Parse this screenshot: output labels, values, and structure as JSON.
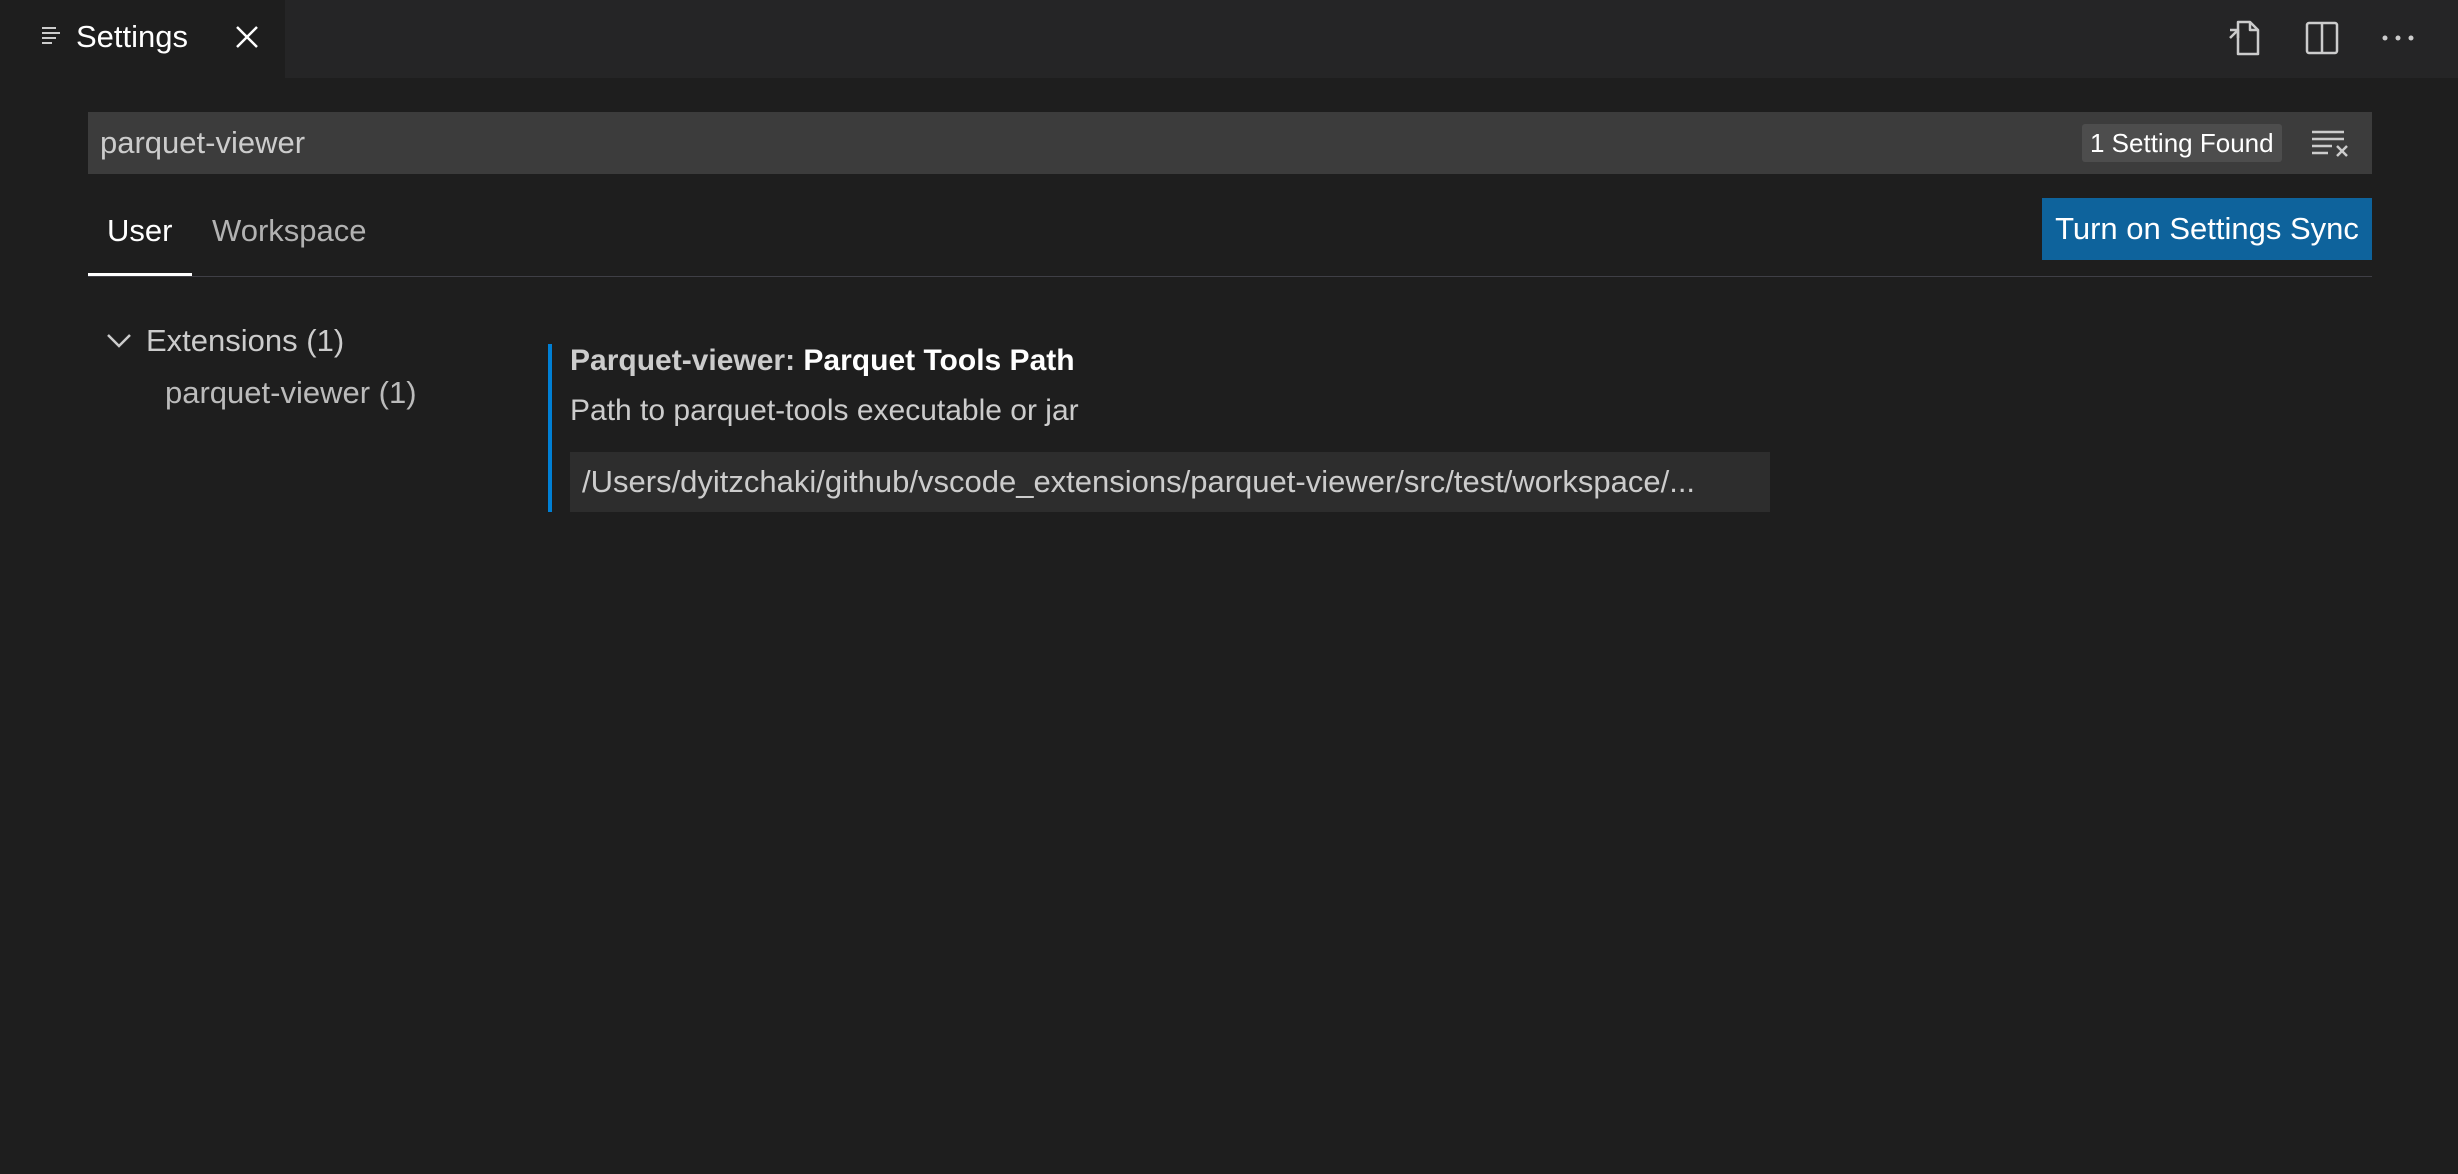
{
  "tab": {
    "title": "Settings"
  },
  "search": {
    "value": "parquet-viewer",
    "result_count": "1 Setting Found"
  },
  "scopes": {
    "user": "User",
    "workspace": "Workspace"
  },
  "sync_button": "Turn on Settings Sync",
  "toc": {
    "group": "Extensions (1)",
    "item": "parquet-viewer (1)"
  },
  "setting": {
    "category": "Parquet-viewer: ",
    "name": "Parquet Tools Path",
    "description": "Path to parquet-tools executable or jar",
    "value": "/Users/dyitzchaki/github/vscode_extensions/parquet-viewer/src/test/workspace/..."
  },
  "colors": {
    "background": "#1e1e1e",
    "tabbar": "#252526",
    "input": "#3c3c3c",
    "accent_button": "#0e639c",
    "modified_indicator": "#007fd4"
  },
  "icons": {
    "tab": "settings-list-icon",
    "close": "close-icon",
    "open_json": "open-settings-json-icon",
    "split": "split-editor-icon",
    "more": "more-actions-icon",
    "clear": "clear-filter-icon",
    "chevron": "chevron-down-icon"
  }
}
